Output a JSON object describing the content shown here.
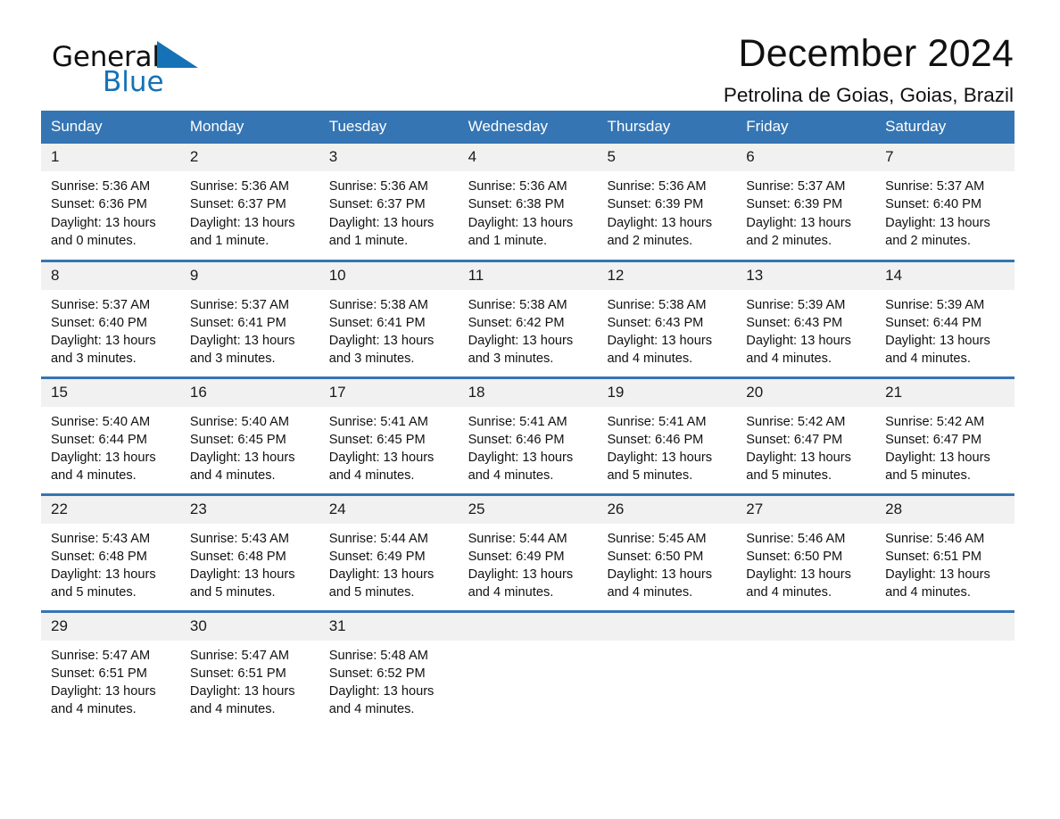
{
  "brand": {
    "line1": "General",
    "line2": "Blue",
    "triangle_icon": "brand-triangle-icon",
    "accent_color": "#1572b6"
  },
  "header": {
    "title": "December 2024",
    "location": "Petrolina de Goias, Goias, Brazil"
  },
  "colors": {
    "header_band": "#3575b3",
    "daynum_band": "#f1f1f1",
    "text": "#111111"
  },
  "calendar": {
    "weekday_headers": [
      "Sunday",
      "Monday",
      "Tuesday",
      "Wednesday",
      "Thursday",
      "Friday",
      "Saturday"
    ],
    "weeks": [
      [
        {
          "day": "1",
          "sunrise": "Sunrise: 5:36 AM",
          "sunset": "Sunset: 6:36 PM",
          "daylight1": "Daylight: 13 hours",
          "daylight2": "and 0 minutes."
        },
        {
          "day": "2",
          "sunrise": "Sunrise: 5:36 AM",
          "sunset": "Sunset: 6:37 PM",
          "daylight1": "Daylight: 13 hours",
          "daylight2": "and 1 minute."
        },
        {
          "day": "3",
          "sunrise": "Sunrise: 5:36 AM",
          "sunset": "Sunset: 6:37 PM",
          "daylight1": "Daylight: 13 hours",
          "daylight2": "and 1 minute."
        },
        {
          "day": "4",
          "sunrise": "Sunrise: 5:36 AM",
          "sunset": "Sunset: 6:38 PM",
          "daylight1": "Daylight: 13 hours",
          "daylight2": "and 1 minute."
        },
        {
          "day": "5",
          "sunrise": "Sunrise: 5:36 AM",
          "sunset": "Sunset: 6:39 PM",
          "daylight1": "Daylight: 13 hours",
          "daylight2": "and 2 minutes."
        },
        {
          "day": "6",
          "sunrise": "Sunrise: 5:37 AM",
          "sunset": "Sunset: 6:39 PM",
          "daylight1": "Daylight: 13 hours",
          "daylight2": "and 2 minutes."
        },
        {
          "day": "7",
          "sunrise": "Sunrise: 5:37 AM",
          "sunset": "Sunset: 6:40 PM",
          "daylight1": "Daylight: 13 hours",
          "daylight2": "and 2 minutes."
        }
      ],
      [
        {
          "day": "8",
          "sunrise": "Sunrise: 5:37 AM",
          "sunset": "Sunset: 6:40 PM",
          "daylight1": "Daylight: 13 hours",
          "daylight2": "and 3 minutes."
        },
        {
          "day": "9",
          "sunrise": "Sunrise: 5:37 AM",
          "sunset": "Sunset: 6:41 PM",
          "daylight1": "Daylight: 13 hours",
          "daylight2": "and 3 minutes."
        },
        {
          "day": "10",
          "sunrise": "Sunrise: 5:38 AM",
          "sunset": "Sunset: 6:41 PM",
          "daylight1": "Daylight: 13 hours",
          "daylight2": "and 3 minutes."
        },
        {
          "day": "11",
          "sunrise": "Sunrise: 5:38 AM",
          "sunset": "Sunset: 6:42 PM",
          "daylight1": "Daylight: 13 hours",
          "daylight2": "and 3 minutes."
        },
        {
          "day": "12",
          "sunrise": "Sunrise: 5:38 AM",
          "sunset": "Sunset: 6:43 PM",
          "daylight1": "Daylight: 13 hours",
          "daylight2": "and 4 minutes."
        },
        {
          "day": "13",
          "sunrise": "Sunrise: 5:39 AM",
          "sunset": "Sunset: 6:43 PM",
          "daylight1": "Daylight: 13 hours",
          "daylight2": "and 4 minutes."
        },
        {
          "day": "14",
          "sunrise": "Sunrise: 5:39 AM",
          "sunset": "Sunset: 6:44 PM",
          "daylight1": "Daylight: 13 hours",
          "daylight2": "and 4 minutes."
        }
      ],
      [
        {
          "day": "15",
          "sunrise": "Sunrise: 5:40 AM",
          "sunset": "Sunset: 6:44 PM",
          "daylight1": "Daylight: 13 hours",
          "daylight2": "and 4 minutes."
        },
        {
          "day": "16",
          "sunrise": "Sunrise: 5:40 AM",
          "sunset": "Sunset: 6:45 PM",
          "daylight1": "Daylight: 13 hours",
          "daylight2": "and 4 minutes."
        },
        {
          "day": "17",
          "sunrise": "Sunrise: 5:41 AM",
          "sunset": "Sunset: 6:45 PM",
          "daylight1": "Daylight: 13 hours",
          "daylight2": "and 4 minutes."
        },
        {
          "day": "18",
          "sunrise": "Sunrise: 5:41 AM",
          "sunset": "Sunset: 6:46 PM",
          "daylight1": "Daylight: 13 hours",
          "daylight2": "and 4 minutes."
        },
        {
          "day": "19",
          "sunrise": "Sunrise: 5:41 AM",
          "sunset": "Sunset: 6:46 PM",
          "daylight1": "Daylight: 13 hours",
          "daylight2": "and 5 minutes."
        },
        {
          "day": "20",
          "sunrise": "Sunrise: 5:42 AM",
          "sunset": "Sunset: 6:47 PM",
          "daylight1": "Daylight: 13 hours",
          "daylight2": "and 5 minutes."
        },
        {
          "day": "21",
          "sunrise": "Sunrise: 5:42 AM",
          "sunset": "Sunset: 6:47 PM",
          "daylight1": "Daylight: 13 hours",
          "daylight2": "and 5 minutes."
        }
      ],
      [
        {
          "day": "22",
          "sunrise": "Sunrise: 5:43 AM",
          "sunset": "Sunset: 6:48 PM",
          "daylight1": "Daylight: 13 hours",
          "daylight2": "and 5 minutes."
        },
        {
          "day": "23",
          "sunrise": "Sunrise: 5:43 AM",
          "sunset": "Sunset: 6:48 PM",
          "daylight1": "Daylight: 13 hours",
          "daylight2": "and 5 minutes."
        },
        {
          "day": "24",
          "sunrise": "Sunrise: 5:44 AM",
          "sunset": "Sunset: 6:49 PM",
          "daylight1": "Daylight: 13 hours",
          "daylight2": "and 5 minutes."
        },
        {
          "day": "25",
          "sunrise": "Sunrise: 5:44 AM",
          "sunset": "Sunset: 6:49 PM",
          "daylight1": "Daylight: 13 hours",
          "daylight2": "and 4 minutes."
        },
        {
          "day": "26",
          "sunrise": "Sunrise: 5:45 AM",
          "sunset": "Sunset: 6:50 PM",
          "daylight1": "Daylight: 13 hours",
          "daylight2": "and 4 minutes."
        },
        {
          "day": "27",
          "sunrise": "Sunrise: 5:46 AM",
          "sunset": "Sunset: 6:50 PM",
          "daylight1": "Daylight: 13 hours",
          "daylight2": "and 4 minutes."
        },
        {
          "day": "28",
          "sunrise": "Sunrise: 5:46 AM",
          "sunset": "Sunset: 6:51 PM",
          "daylight1": "Daylight: 13 hours",
          "daylight2": "and 4 minutes."
        }
      ],
      [
        {
          "day": "29",
          "sunrise": "Sunrise: 5:47 AM",
          "sunset": "Sunset: 6:51 PM",
          "daylight1": "Daylight: 13 hours",
          "daylight2": "and 4 minutes."
        },
        {
          "day": "30",
          "sunrise": "Sunrise: 5:47 AM",
          "sunset": "Sunset: 6:51 PM",
          "daylight1": "Daylight: 13 hours",
          "daylight2": "and 4 minutes."
        },
        {
          "day": "31",
          "sunrise": "Sunrise: 5:48 AM",
          "sunset": "Sunset: 6:52 PM",
          "daylight1": "Daylight: 13 hours",
          "daylight2": "and 4 minutes."
        },
        {
          "day": "",
          "sunrise": "",
          "sunset": "",
          "daylight1": "",
          "daylight2": ""
        },
        {
          "day": "",
          "sunrise": "",
          "sunset": "",
          "daylight1": "",
          "daylight2": ""
        },
        {
          "day": "",
          "sunrise": "",
          "sunset": "",
          "daylight1": "",
          "daylight2": ""
        },
        {
          "day": "",
          "sunrise": "",
          "sunset": "",
          "daylight1": "",
          "daylight2": ""
        }
      ]
    ]
  }
}
